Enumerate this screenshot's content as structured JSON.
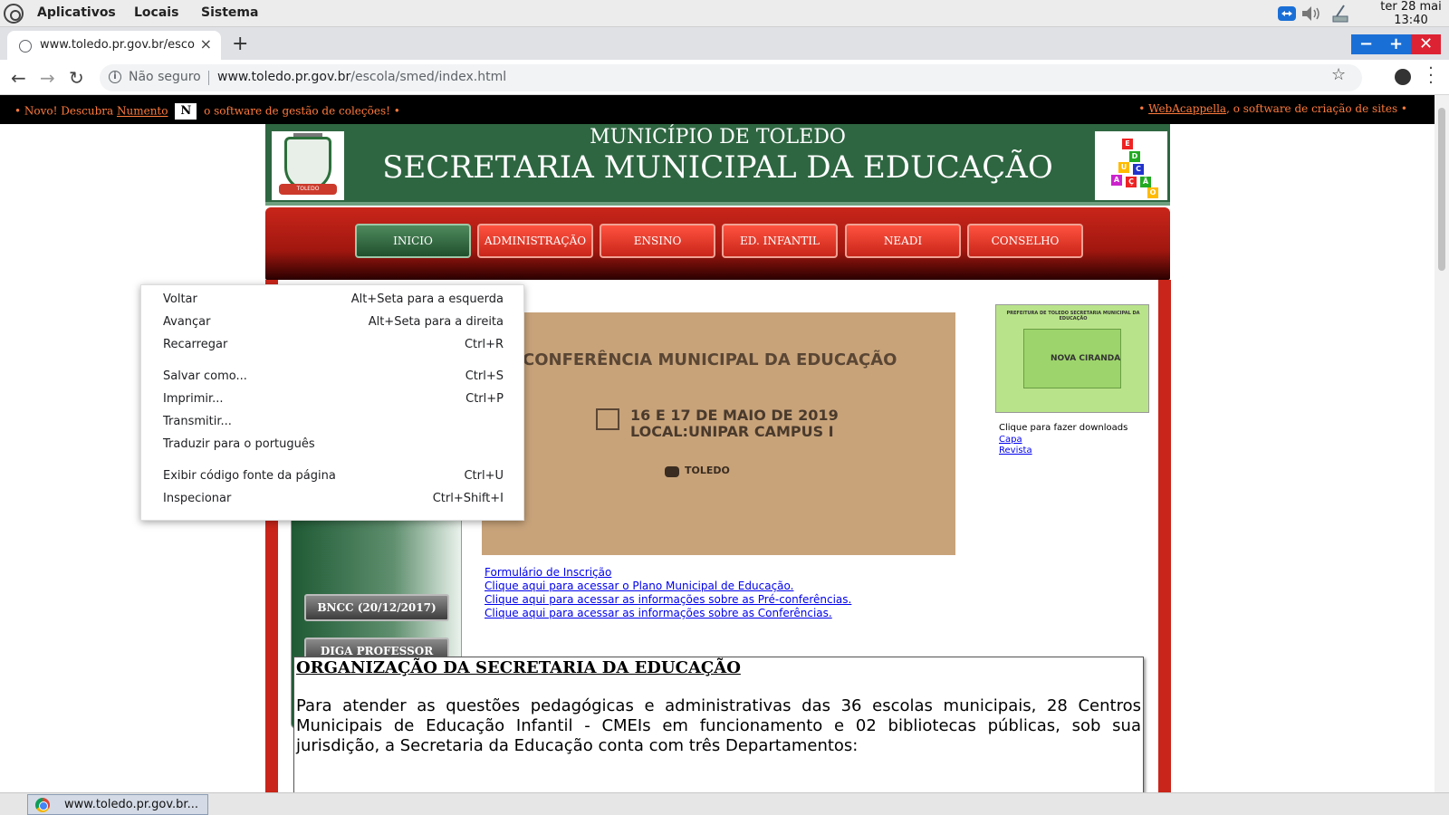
{
  "os_panel": {
    "menus": [
      "Aplicativos",
      "Locais",
      "Sistema"
    ],
    "clock_date": "ter 28 mai",
    "clock_time": "13:40"
  },
  "browser": {
    "tab_title": "www.toledo.pr.gov.br/esco",
    "new_tab": "+",
    "close": "×",
    "security_label": "Não seguro",
    "url_host": "www.toledo.pr.gov.br",
    "url_path": "/escola/smed/index.html",
    "window_controls": [
      "−",
      "+",
      "✕"
    ]
  },
  "adbar": {
    "left_prefix": "• Novo! Descubra ",
    "left_link": "Numento",
    "left_logo": "N",
    "left_suffix": " o software de gestão de coleções! •",
    "right_prefix": "• ",
    "right_link": "WebAcappella",
    "right_suffix": ", o software de criação de sites •"
  },
  "site": {
    "municipality": "MUNICÍPIO DE TOLEDO",
    "secretariat": "SECRETARIA MUNICIPAL DA EDUCAÇÃO",
    "coat_label": "TOLEDO",
    "nav": [
      "INICIO",
      "ADMINISTRAÇÃO",
      "ENSINO",
      "ED. INFANTIL",
      "NEADI",
      "CONSELHO"
    ],
    "banner": {
      "title": "CONFERÊNCIA MUNICIPAL DA EDUCAÇÃO",
      "dates": "16 E 17 DE MAIO DE 2019",
      "location": "LOCAL:UNIPAR CAMPUS I",
      "logo": "TOLEDO"
    },
    "links": [
      "Formulário de Inscrição",
      "Clique aqui para acessar o Plano Municipal de Educação.",
      "Clique aqui para acessar as informações sobre as Pré-conferências.",
      "Clique aqui para acessar as informações sobre as Conferências."
    ],
    "side_buttons": [
      "BNCC (20/12/2017)",
      "DIGA PROFESSOR"
    ],
    "magazine": {
      "header": "PREFEITURA DE TOLEDO SECRETARIA MUNICIPAL DA EDUCAÇÃO",
      "title": "NOVA CIRANDA",
      "download_label": "Clique para fazer downloads",
      "link_capa": "Capa",
      "link_revista": "Revista"
    },
    "org_title": "ORGANIZAÇÃO DA SECRETARIA DA EDUCAÇÃO",
    "org_text": "Para atender as questões pedagógicas e administrativas das 36 escolas municipais, 28 Centros Municipais de Educação Infantil - CMEIs em funcionamento e 02 bibliotecas públicas, sob sua jurisdição, a Secretaria da Educação conta com três Departamentos:"
  },
  "context_menu": [
    {
      "label": "Voltar",
      "key": "Alt+Seta para a esquerda"
    },
    {
      "label": "Avançar",
      "key": "Alt+Seta para a direita"
    },
    {
      "label": "Recarregar",
      "key": "Ctrl+R"
    },
    {
      "label": "Salvar como...",
      "key": "Ctrl+S"
    },
    {
      "label": "Imprimir...",
      "key": "Ctrl+P"
    },
    {
      "label": "Transmitir...",
      "key": ""
    },
    {
      "label": "Traduzir para o português",
      "key": ""
    },
    {
      "label": "Exibir código fonte da página",
      "key": "Ctrl+U"
    },
    {
      "label": "Inspecionar",
      "key": "Ctrl+Shift+I"
    }
  ],
  "taskbar": {
    "item_label": "www.toledo.pr.gov.br..."
  },
  "colors": {
    "header_green": "#2e6641",
    "nav_red": "#c9251a",
    "link_blue": "#0000ee",
    "adbar_orange": "#ff7a3c"
  }
}
